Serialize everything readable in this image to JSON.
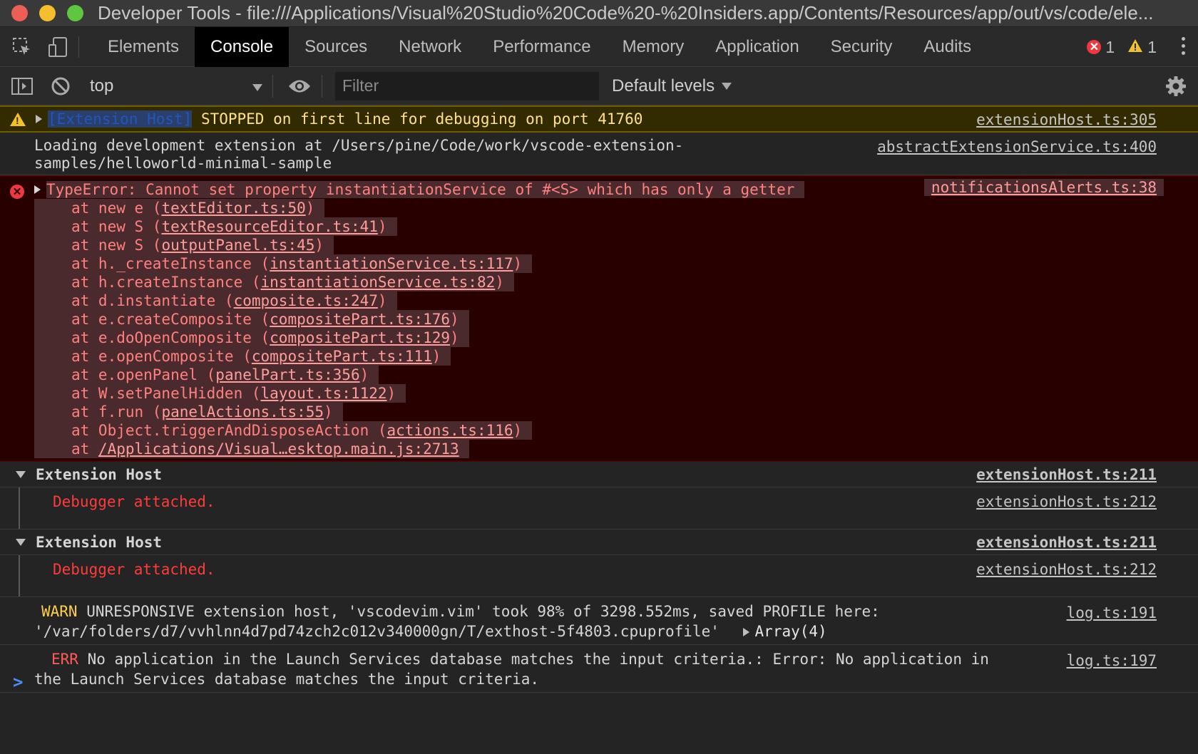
{
  "window": {
    "title": "Developer Tools - file:///Applications/Visual%20Studio%20Code%20-%20Insiders.app/Contents/Resources/app/out/vs/code/ele..."
  },
  "tabs": [
    "Elements",
    "Console",
    "Sources",
    "Network",
    "Performance",
    "Memory",
    "Application",
    "Security",
    "Audits"
  ],
  "active_tab": "Console",
  "counts": {
    "errors": "1",
    "warnings": "1"
  },
  "filterbar": {
    "context": "top",
    "filter_placeholder": "Filter",
    "levels": "Default levels"
  },
  "messages": {
    "stopped": {
      "prefix": "[Extension Host]",
      "text": " STOPPED on first line for debugging on port 41760",
      "source": "extensionHost.ts:305"
    },
    "loading": {
      "line1": "Loading development extension at /Users/pine/Code/work/vscode-extension-",
      "line2": "samples/helloworld-minimal-sample",
      "source": "abstractExtensionService.ts:400"
    },
    "type_error": {
      "message": "TypeError: Cannot set property instantiationService of #<S> which has only a getter",
      "source": "notificationsAlerts.ts:38",
      "stack": [
        {
          "fn": "at new e (",
          "loc": "textEditor.ts:50",
          "end": ")"
        },
        {
          "fn": "at new S (",
          "loc": "textResourceEditor.ts:41",
          "end": ")"
        },
        {
          "fn": "at new S (",
          "loc": "outputPanel.ts:45",
          "end": ")"
        },
        {
          "fn": "at h._createInstance (",
          "loc": "instantiationService.ts:117",
          "end": ")"
        },
        {
          "fn": "at h.createInstance (",
          "loc": "instantiationService.ts:82",
          "end": ")"
        },
        {
          "fn": "at d.instantiate (",
          "loc": "composite.ts:247",
          "end": ")"
        },
        {
          "fn": "at e.createComposite (",
          "loc": "compositePart.ts:176",
          "end": ")"
        },
        {
          "fn": "at e.doOpenComposite (",
          "loc": "compositePart.ts:129",
          "end": ")"
        },
        {
          "fn": "at e.openComposite (",
          "loc": "compositePart.ts:111",
          "end": ")"
        },
        {
          "fn": "at e.openPanel (",
          "loc": "panelPart.ts:356",
          "end": ")"
        },
        {
          "fn": "at W.setPanelHidden (",
          "loc": "layout.ts:1122",
          "end": ")"
        },
        {
          "fn": "at f.run (",
          "loc": "panelActions.ts:55",
          "end": ")"
        },
        {
          "fn": "at Object.triggerAndDisposeAction (",
          "loc": "actions.ts:116",
          "end": ")"
        },
        {
          "fn": "at ",
          "loc": "/Applications/Visual…esktop.main.js:2713",
          "end": ""
        }
      ]
    },
    "groups": [
      {
        "title": "Extension Host",
        "source": "extensionHost.ts:211",
        "child": "Debugger attached.",
        "child_source": "extensionHost.ts:212"
      },
      {
        "title": "Extension Host",
        "source": "extensionHost.ts:211",
        "child": "Debugger attached.",
        "child_source": "extensionHost.ts:212"
      }
    ],
    "unresponsive": {
      "tag": "WARN",
      "line1": " UNRESPONSIVE extension host, 'vscodevim.vim' took 98% of 3298.552ms, saved PROFILE here:",
      "line2": "'/var/folders/d7/vvhlnn4d7pd74zch2c012v340000gn/T/exthost-5f4803.cpuprofile'",
      "array": "Array(4)",
      "source": "log.ts:191"
    },
    "launch_error": {
      "tag": "ERR",
      "line1": " No application in the Launch Services database matches the input criteria.: Error: No application in",
      "line2": "the Launch Services database matches the input criteria.",
      "source": "log.ts:197"
    }
  },
  "prompt": ">"
}
